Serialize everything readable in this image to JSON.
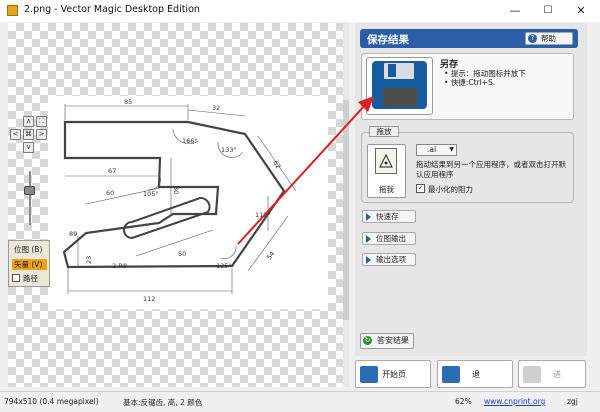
{
  "window": {
    "title": "2.png - Vector Magic Desktop Edition",
    "min_glyph": "—",
    "max_glyph": "☐",
    "close_glyph": "✕"
  },
  "nav": {
    "up": "∧",
    "down": "∨",
    "left": "<",
    "right": ">",
    "fit": "⌘",
    "expand": "⛶",
    "zoom_level": 0.64
  },
  "view_options": {
    "bitmap": "位图 (B)",
    "vector": "矢量 (V)",
    "path": "路径"
  },
  "drawing_dims": {
    "d85": "85",
    "d32": "32",
    "d166": "166°",
    "d133": "133°",
    "d67": "67",
    "d30": "30",
    "d60": "60",
    "d105": "105°",
    "d50": "50",
    "d2r8": "2-R8",
    "d23": "23",
    "d62": "62",
    "d112": "112",
    "d125": "125°",
    "d112deg": "112°",
    "d54": "54",
    "d89": "89"
  },
  "panel": {
    "title": "保存结果",
    "help": "帮助",
    "save_as": {
      "title": "另存",
      "tip1": "提示：拖动图标并放下",
      "tip2": "快捷:Ctrl+S."
    },
    "drag": {
      "tab": "拖放",
      "caption": "拖我",
      "extension": ".ai",
      "description": "拖动结果到另一个应用程序，或者双击打开默认应用程序",
      "minimize_label": "最小化的阻力",
      "minimize_checked": true,
      "check_glyph": "✓"
    },
    "nav_items": [
      "快速存",
      "位图输出",
      "输出选项"
    ],
    "save_result": "答安结果"
  },
  "bottom_nav": {
    "start": "开始页",
    "back": "退",
    "forward": "进"
  },
  "status": {
    "dimensions": "794x510 (0.4 megapixel)",
    "info": "基本:反锯齿, 高, 2 颜色",
    "zoom": "62%",
    "link": "www.cnprint.org",
    "extra": "zgj"
  },
  "colors": {
    "accent": "#2b5ea8",
    "arrow": "#e02020",
    "active_option": "#f0a020"
  }
}
